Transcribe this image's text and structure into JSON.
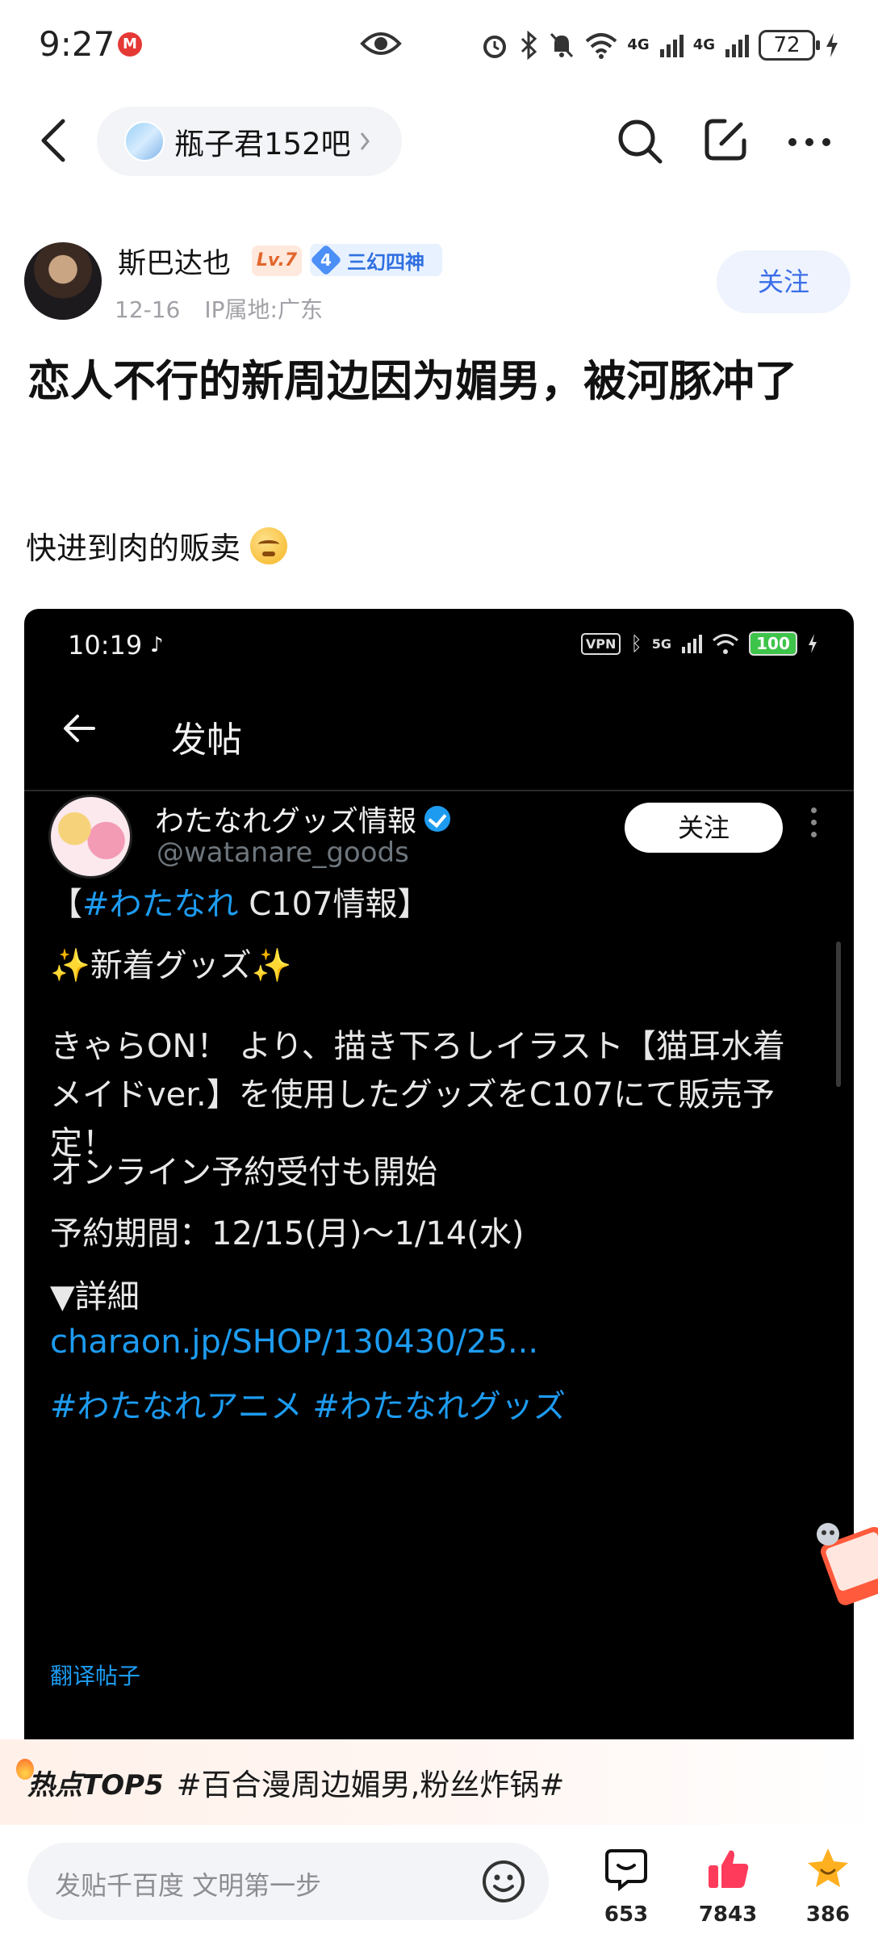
{
  "status_bar": {
    "time": "9:27",
    "net1": "4G",
    "net2": "4G",
    "battery": "72"
  },
  "nav": {
    "forum_name": "瓶子君152吧"
  },
  "author": {
    "name": "斯巴达也",
    "level": "Lv.7",
    "title_level": "4",
    "title": "三幻四神",
    "date": "12-16",
    "location": "IP属地:广东",
    "follow_label": "关注"
  },
  "post": {
    "title": "恋人不行的新周边因为媚男，被河豚冲了",
    "body": "快进到肉的贩卖"
  },
  "embed": {
    "time": "10:19",
    "vpn": "VPN",
    "net": "5G",
    "battery": "100",
    "header": "发帖",
    "account_name": "わたなれグッズ情報",
    "handle": "@watanare_goods",
    "follow_label": "关注",
    "line1_bracket_open": "【",
    "line1_tag": "#わたなれ",
    "line1_rest": " C107情報】",
    "line2_text": "新着グッズ",
    "para1": "きゃらON！ より、描き下ろしイラスト【猫耳水着\nメイドver.】を使用したグッズをC107にて販売予\n定！",
    "para2": "オンライン予約受付も開始",
    "para3": "予約期間：12/15(月)〜1/14(水)",
    "details": "▼詳細",
    "link": "charaon.jp/SHOP/130430/25...",
    "hashtags": "#わたなれアニメ #わたなれグッズ",
    "translate": "翻译帖子"
  },
  "hot": {
    "label": "热点TOP5",
    "topic": "#百合漫周边媚男,粉丝炸锅#"
  },
  "bottom": {
    "placeholder": "发贴千百度 文明第一步",
    "comments": "653",
    "likes": "7843",
    "favorites": "386"
  }
}
